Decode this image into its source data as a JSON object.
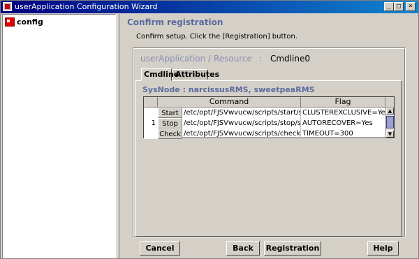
{
  "window": {
    "title": "userApplication Configuration Wizard",
    "controls": {
      "minimize": "_",
      "maximize": "□",
      "close": "×"
    }
  },
  "tree": {
    "items": [
      {
        "label": "config",
        "icon": "config-icon"
      }
    ]
  },
  "main": {
    "heading": "Confirm registration",
    "instructions": "Confirm setup.  Click the [Registration] button.",
    "resource": {
      "label": "userApplication / Resource",
      "separator": ":",
      "value": "Cmdline0"
    },
    "tabs": [
      {
        "label": "Cmdline",
        "active": true
      },
      {
        "label": "Attributes",
        "active": false
      }
    ],
    "sysnode": "SysNode : narcissusRMS, sweetpeaRMS",
    "table": {
      "columns": [
        "",
        "Command",
        "Flag"
      ],
      "row_index": "1",
      "rows": [
        {
          "label": "Start",
          "command": "/etc/opt/FJSVwvucw/scripts/start/start",
          "flag": "CLUSTEREXCLUSIVE=Yes"
        },
        {
          "label": "Stop",
          "command": "/etc/opt/FJSVwvucw/scripts/stop/stop",
          "flag": "AUTORECOVER=Yes"
        },
        {
          "label": "Check",
          "command": "/etc/opt/FJSVwvucw/scripts/check/ch...",
          "flag": "TIMEOUT=300"
        }
      ]
    }
  },
  "buttons": {
    "cancel": "Cancel",
    "back": "Back",
    "registration": "Registration",
    "help": "Help"
  },
  "colors": {
    "titlebar": "#000080",
    "heading": "#5b6a9e",
    "resource_label": "#8a8fb5"
  }
}
